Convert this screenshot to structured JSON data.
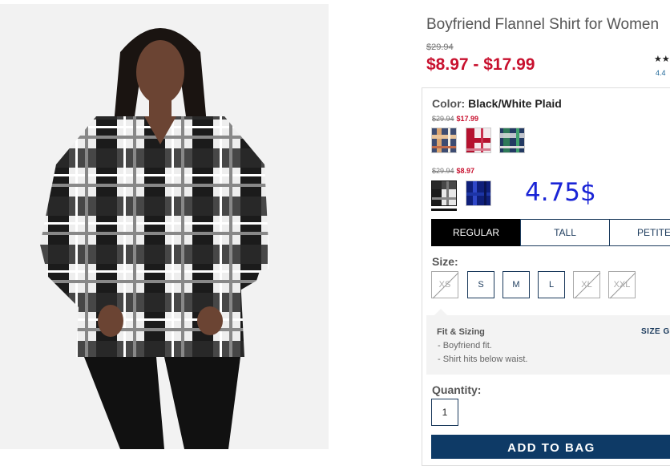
{
  "product": {
    "title": "Boyfriend Flannel Shirt for Women",
    "original_price": "$29.94",
    "price_range": "$8.97 - $17.99",
    "rating_stars": "★★",
    "rating_value": "4.4",
    "image_name": "model-wearing-plaid-shirt"
  },
  "color": {
    "label": "Color:",
    "value": "Black/White Plaid",
    "groups": [
      {
        "was": "$29.94",
        "now": "$17.99",
        "swatches": [
          "plaid-tan-navy",
          "plaid-red-white",
          "plaid-green-navy"
        ]
      },
      {
        "was": "$29.94",
        "now": "$8.97",
        "swatches": [
          "plaid-black-white",
          "plaid-navy-blue"
        ]
      }
    ],
    "selected": "plaid-black-white"
  },
  "overlay_price": "4.75$",
  "fit_tabs": [
    "REGULAR",
    "TALL",
    "PETITE"
  ],
  "fit_selected": "REGULAR",
  "size": {
    "label": "Size:",
    "options": [
      {
        "label": "XS",
        "available": false
      },
      {
        "label": "S",
        "available": true
      },
      {
        "label": "M",
        "available": true
      },
      {
        "label": "L",
        "available": true
      },
      {
        "label": "XL",
        "available": false
      },
      {
        "label": "XXL",
        "available": false
      }
    ]
  },
  "fit_sizing": {
    "title": "Fit & Sizing",
    "size_guide": "SIZE GU",
    "items": [
      "-  Boyfriend fit.",
      "-  Shirt hits below waist."
    ]
  },
  "quantity": {
    "label": "Quantity:",
    "value": "1"
  },
  "add_to_bag": "ADD TO BAG",
  "colors": {
    "sale_red": "#c8102e",
    "navy": "#0e3a66",
    "overlay_blue": "#1a24d6"
  }
}
